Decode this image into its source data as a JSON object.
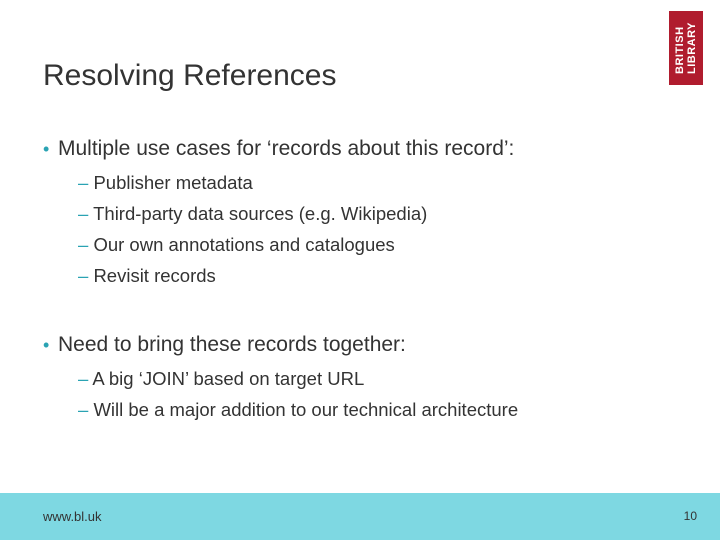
{
  "logo": {
    "line1": "BRITISH",
    "line2": "LIBRARY"
  },
  "slide": {
    "title": "Resolving References",
    "bullets": [
      {
        "text": "Multiple use cases for ‘records about this record’:",
        "subs": [
          "Publisher metadata",
          "Third-party data sources (e.g. Wikipedia)",
          "Our own annotations and catalogues",
          "Revisit records"
        ]
      },
      {
        "text": "Need to bring these records together:",
        "subs": [
          "A big ‘JOIN’ based on target URL",
          "Will be a major addition to our technical architecture"
        ]
      }
    ]
  },
  "footer": {
    "url": "www.bl.uk",
    "page_number": "10"
  },
  "colors": {
    "accent": "#2aa3b3",
    "footer_bg": "#7ed8e2",
    "logo_bg": "#b01c2e"
  }
}
